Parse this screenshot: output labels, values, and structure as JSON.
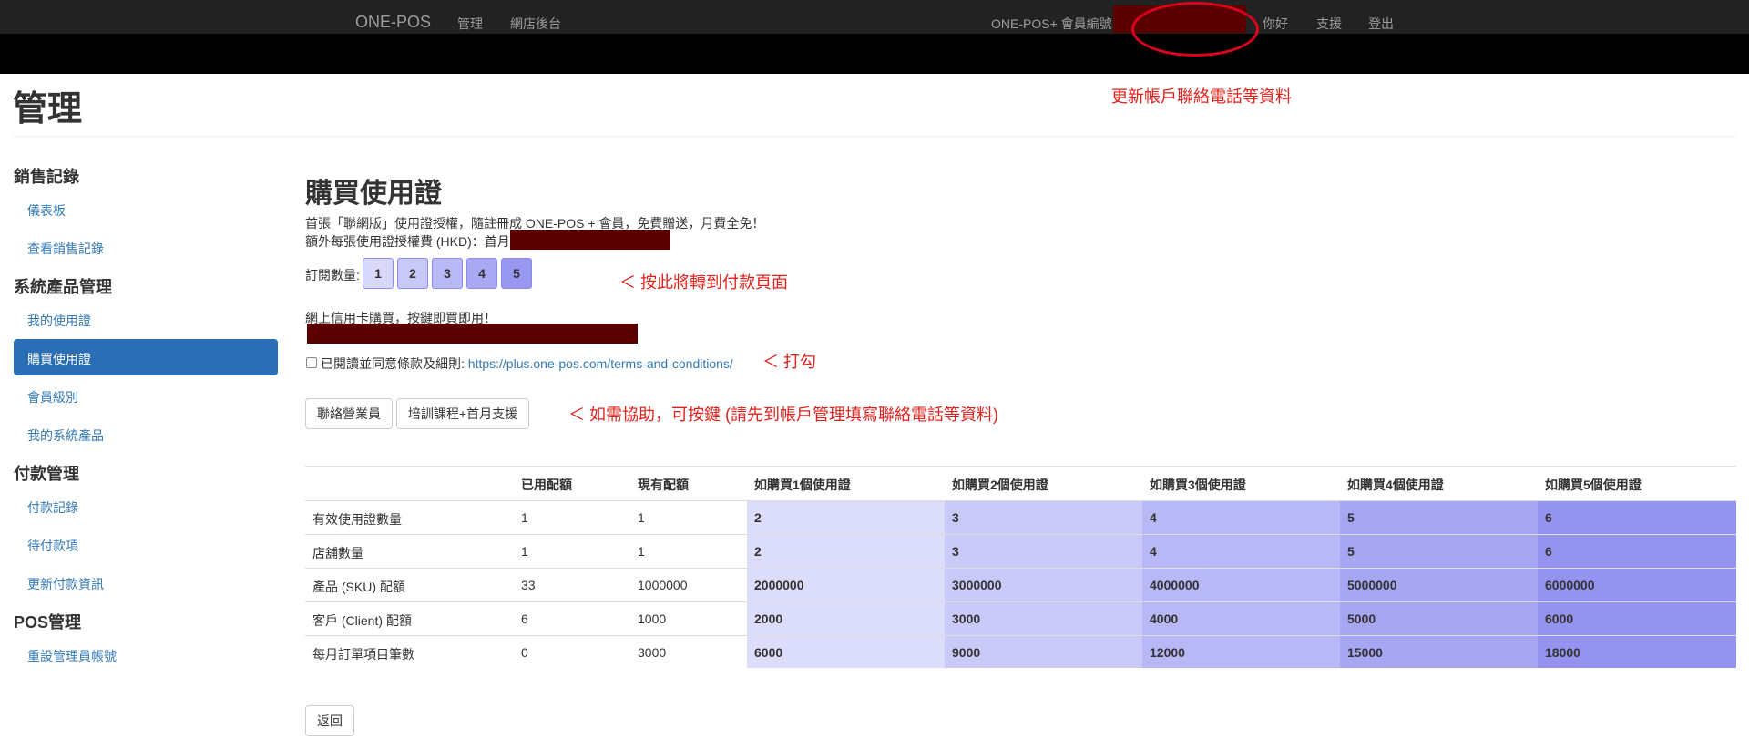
{
  "nav": {
    "brand": "ONE-POS",
    "links": [
      "管理",
      "網店後台"
    ],
    "member_label": "ONE-POS+ 會員編號",
    "greeting": "你好",
    "support": "支援",
    "logout": "登出"
  },
  "header": {
    "title": "管理"
  },
  "annotations": {
    "update_account": "更新帳戶聯絡電話等資料",
    "payment_page": "＜ 按此將轉到付款頁面",
    "tick": "＜ 打勾",
    "help": "＜ 如需協助，可按鍵 (請先到帳戶管理填寫聯絡電話等資料)"
  },
  "sidebar": {
    "sections": [
      {
        "title": "銷售記錄",
        "items": [
          "儀表板",
          "查看銷售記錄"
        ]
      },
      {
        "title": "系統產品管理",
        "items": [
          "我的使用證",
          "購買使用證",
          "會員級別",
          "我的系統產品"
        ]
      },
      {
        "title": "付款管理",
        "items": [
          "付款記錄",
          "待付款項",
          "更新付款資訊"
        ]
      },
      {
        "title": "POS管理",
        "items": [
          "重設管理員帳號"
        ]
      }
    ],
    "active": "購買使用證"
  },
  "main": {
    "title": "購買使用證",
    "intro": "首張「聯網版」使用證授權，隨註冊成 ONE-POS + 會員，免費贈送，月費全免！",
    "fee_label": "額外每張使用證授權費 (HKD)：首月",
    "qty_label": "訂閱數量:",
    "qty_options": [
      "1",
      "2",
      "3",
      "4",
      "5"
    ],
    "online_text": "網上信用卡購買，按鍵即買即用！",
    "terms_label": "已閱讀並同意條款及細則:",
    "terms_link": "https://plus.one-pos.com/terms-and-conditions/",
    "btn_sales": "聯絡營業員",
    "btn_training": "培訓課程+首月支援",
    "back": "返回"
  },
  "table": {
    "headers": [
      "",
      "已用配額",
      "現有配額",
      "如購買1個使用證",
      "如購買2個使用證",
      "如購買3個使用證",
      "如購買4個使用證",
      "如購買5個使用證"
    ],
    "rows": [
      [
        "有效使用證數量",
        "1",
        "1",
        "2",
        "3",
        "4",
        "5",
        "6"
      ],
      [
        "店舖數量",
        "1",
        "1",
        "2",
        "3",
        "4",
        "5",
        "6"
      ],
      [
        "產品 (SKU) 配額",
        "33",
        "1000000",
        "2000000",
        "3000000",
        "4000000",
        "5000000",
        "6000000"
      ],
      [
        "客戶 (Client) 配額",
        "6",
        "1000",
        "2000",
        "3000",
        "4000",
        "5000",
        "6000"
      ],
      [
        "每月訂單項目筆數",
        "0",
        "3000",
        "6000",
        "9000",
        "12000",
        "15000",
        "18000"
      ]
    ]
  },
  "colors": {
    "qty": [
      "#d8d8fb",
      "#c8c8f9",
      "#b8b8f6",
      "#a8a8f3",
      "#9898f0"
    ],
    "cols": [
      "#dcdcfb",
      "#cacaf9",
      "#b8b8f6",
      "#a6a6f3",
      "#9494f0"
    ],
    "redaction": "#5a0000",
    "annotation": "#e0201b"
  }
}
